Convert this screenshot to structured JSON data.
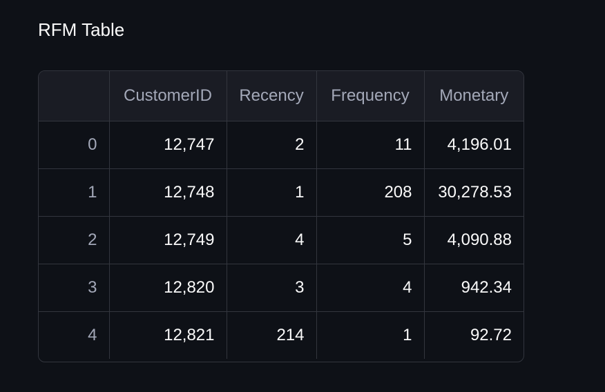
{
  "title": "RFM Table",
  "columns": [
    "",
    "CustomerID",
    "Recency",
    "Frequency",
    "Monetary"
  ],
  "rows": [
    {
      "index": "0",
      "customer_id": "12,747",
      "recency": "2",
      "frequency": "11",
      "monetary": "4,196.01"
    },
    {
      "index": "1",
      "customer_id": "12,748",
      "recency": "1",
      "frequency": "208",
      "monetary": "30,278.53"
    },
    {
      "index": "2",
      "customer_id": "12,749",
      "recency": "4",
      "frequency": "5",
      "monetary": "4,090.88"
    },
    {
      "index": "3",
      "customer_id": "12,820",
      "recency": "3",
      "frequency": "4",
      "monetary": "942.34"
    },
    {
      "index": "4",
      "customer_id": "12,821",
      "recency": "214",
      "frequency": "1",
      "monetary": "92.72"
    }
  ]
}
